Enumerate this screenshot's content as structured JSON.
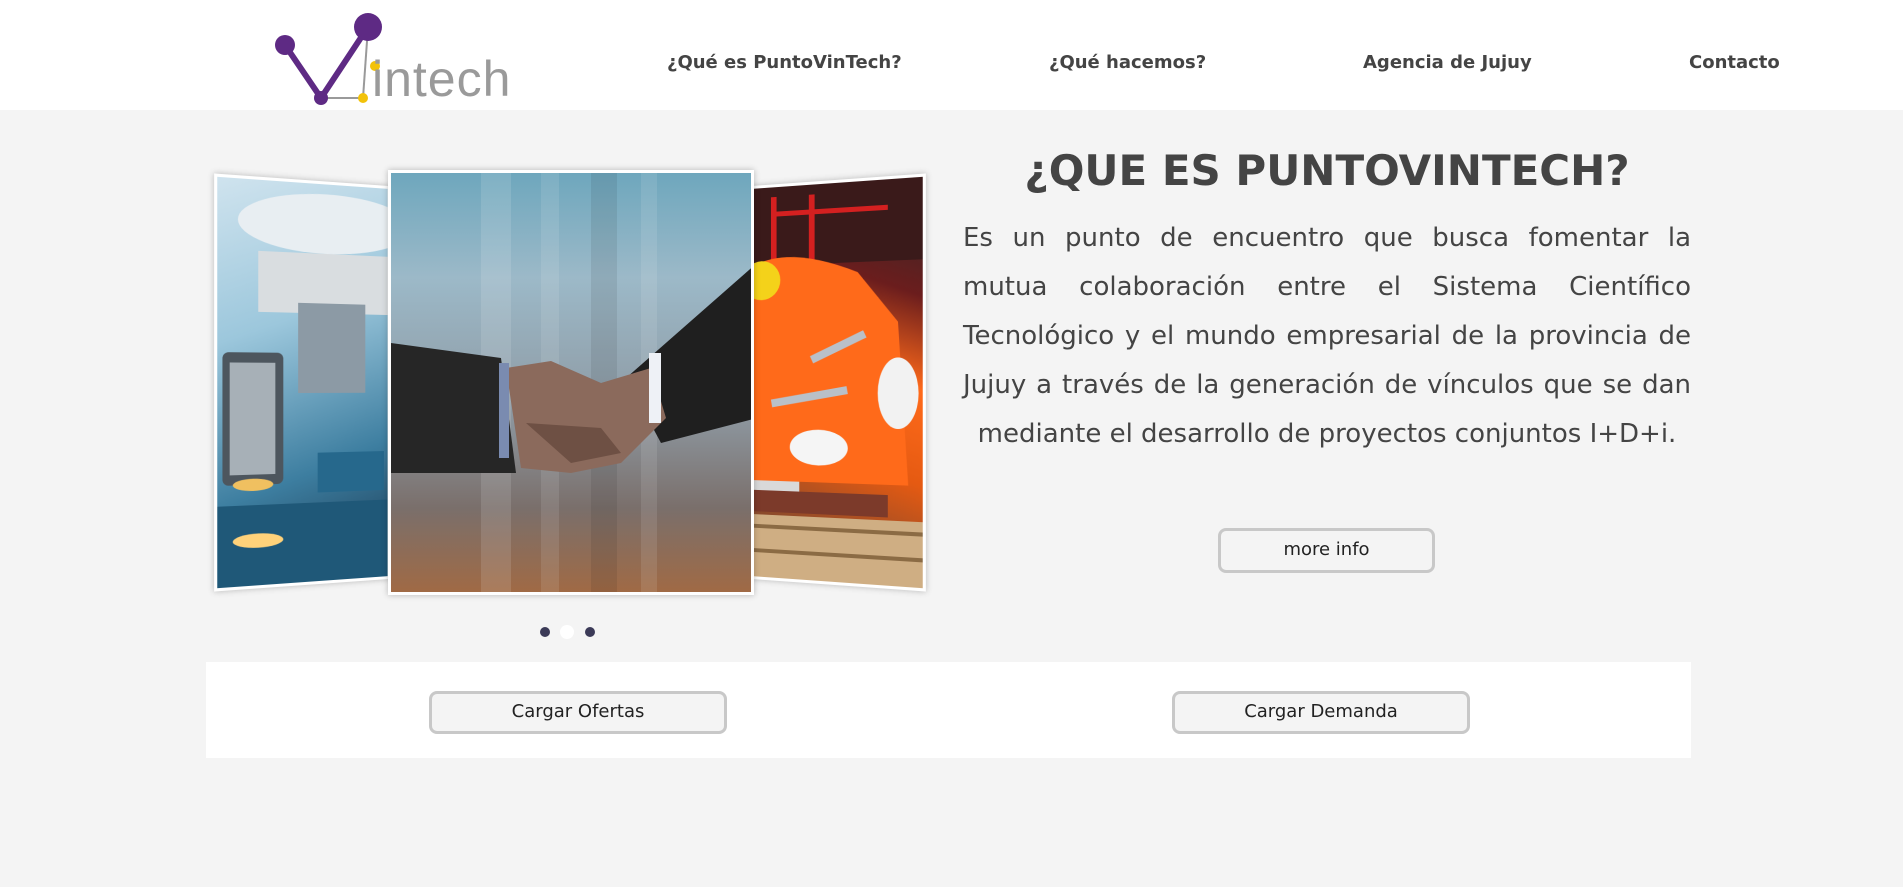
{
  "brand": {
    "logo_text": "intech",
    "logo_alt_letter": "V"
  },
  "nav": {
    "items": [
      {
        "label": "¿Qué es PuntoVinTech?"
      },
      {
        "label": "¿Qué hacemos?"
      },
      {
        "label": "Agencia de Jujuy"
      },
      {
        "label": "Contacto"
      }
    ]
  },
  "carousel": {
    "slides": [
      "microscope",
      "handshake",
      "welder"
    ],
    "active_index": 1,
    "dot_count": 3
  },
  "about": {
    "title": "¿QUE ES PUNTOVINTECH?",
    "text": "Es un punto de encuentro que busca fomentar la mutua colaboración entre el Sistema Científico Tecnológico y el mundo empresarial de la provincia de Jujuy a través de la generación de vínculos que se dan mediante el desarrollo de proyectos conjuntos I+D+i.",
    "more_label": "more info"
  },
  "actions": {
    "ofertas_label": "Cargar Ofertas",
    "demanda_label": "Cargar Demanda"
  },
  "colors": {
    "brand_purple": "#5e2a84",
    "brand_yellow": "#f2c20a",
    "logo_gray": "#9a9a9a",
    "background": "#f4f4f4",
    "text": "#444444"
  }
}
